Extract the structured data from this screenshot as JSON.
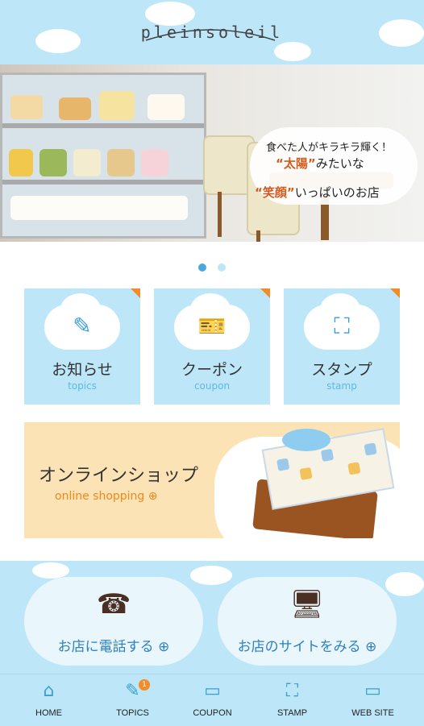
{
  "header": {
    "logo_text": "pleinsoleil"
  },
  "hero": {
    "catch_line1": "食べた人がキラキラ輝く！",
    "catch_line2_accent": "“太陽”",
    "catch_line2_rest": "みたいな",
    "catch_line3_accent": "“笑顔”",
    "catch_line3_rest": "いっぱいのお店"
  },
  "carousel": {
    "dots": 2,
    "active_index": 0
  },
  "menu_tiles": [
    {
      "label": "お知らせ",
      "sublabel": "topics",
      "icon": "pen-icon"
    },
    {
      "label": "クーポン",
      "sublabel": "coupon",
      "icon": "ticket-icon"
    },
    {
      "label": "スタンプ",
      "sublabel": "stamp",
      "icon": "stamp-icon"
    }
  ],
  "banner": {
    "title": "オンラインショップ",
    "subtitle": "online shopping ⊕"
  },
  "actions": [
    {
      "label": "お店に電話する ⊕",
      "icon": "telephone-icon"
    },
    {
      "label": "お店のサイトをみる ⊕",
      "icon": "monitor-icon"
    }
  ],
  "tabbar": {
    "items": [
      {
        "label": "HOME",
        "icon": "home-icon"
      },
      {
        "label": "TOPICS",
        "icon": "pen-icon",
        "badge": "1"
      },
      {
        "label": "COUPON",
        "icon": "ticket-icon"
      },
      {
        "label": "STAMP",
        "icon": "stamp-icon"
      },
      {
        "label": "WEB SITE",
        "icon": "monitor-icon"
      }
    ]
  },
  "colors": {
    "sky": "#bde7f8",
    "accent_orange": "#f28c28",
    "link_blue": "#2f80c0",
    "banner_bg": "#fbe3b6"
  }
}
